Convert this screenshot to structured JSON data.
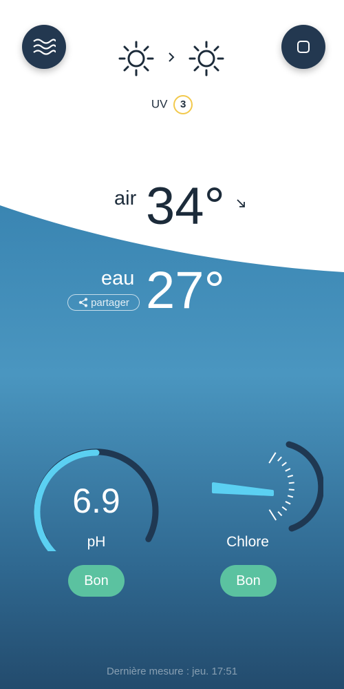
{
  "header": {
    "menu_icon": "waves-icon",
    "stop_icon": "stop-icon"
  },
  "weather": {
    "current_icon": "sun-icon",
    "next_icon": "sun-icon",
    "arrow": "›",
    "uv_label": "UV",
    "uv_index": "3"
  },
  "air": {
    "label": "air",
    "value": "34°",
    "trend_icon": "arrow-down-right-icon"
  },
  "water": {
    "label": "eau",
    "value": "27°",
    "share_label": "partager"
  },
  "ph": {
    "value": "6.9",
    "label": "pH",
    "status": "Bon",
    "level": 0.5
  },
  "chlorine": {
    "label": "Chlore",
    "status": "Bon"
  },
  "footer": {
    "last_measure": "Dernière mesure : jeu. 17:51"
  },
  "colors": {
    "dark": "#233850",
    "accent": "#5bd0f2",
    "good": "#5bc2a0",
    "uv_ring": "#f2c94c"
  }
}
